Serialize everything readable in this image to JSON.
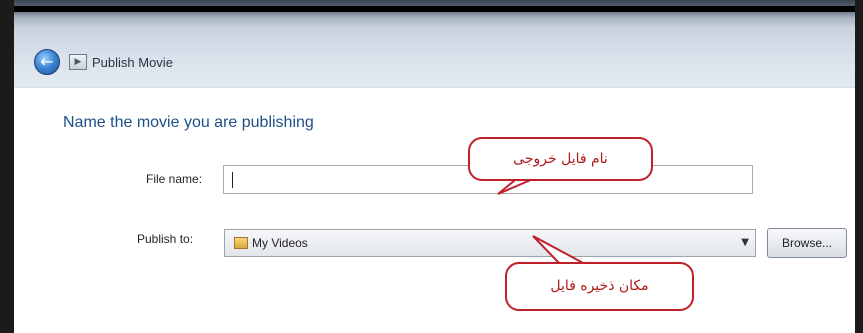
{
  "window": {
    "title": "Publish Movie",
    "back_icon": "back-arrow-icon",
    "title_icon": "movie-icon"
  },
  "main": {
    "heading": "Name the movie you are publishing",
    "file_name_label": "File name:",
    "file_name_value": "",
    "publish_to_label": "Publish to:",
    "publish_to_value": "My Videos",
    "browse_label": "Browse..."
  },
  "annotations": {
    "callout_file_name": "نام فایل خروجی",
    "callout_save_location": "مکان ذخیره فایل"
  },
  "colors": {
    "heading": "#1f4f86",
    "callout_border": "#c0202a",
    "callout_text": "#b01818"
  }
}
